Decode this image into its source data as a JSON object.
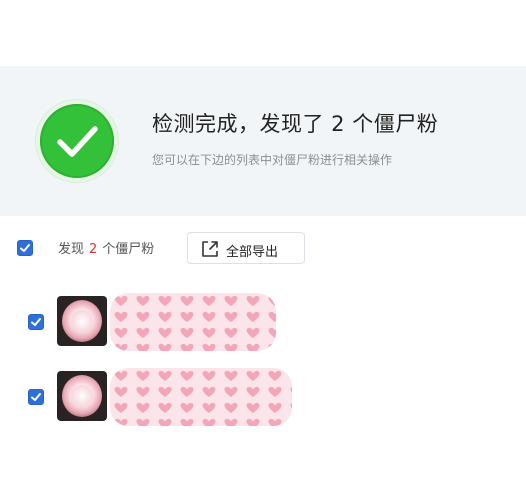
{
  "result": {
    "title": "检测完成，发现了 2 个僵尸粉",
    "subtitle": "您可以在下边的列表中对僵尸粉进行相关操作"
  },
  "summary": {
    "prefix": "发现",
    "count": "2",
    "suffix": "个僵尸粉"
  },
  "export_button": {
    "label": "全部导出",
    "icon": "export-icon"
  },
  "select_all": {
    "checked": true
  },
  "zombie_fans": [
    {
      "checked": true,
      "name_masked": true
    },
    {
      "checked": true,
      "name_masked": true
    }
  ],
  "colors": {
    "accent": "#2f6fd8",
    "success": "#34c13a",
    "count_highlight": "#e0352e",
    "mask_pink": "#f2a6b8"
  }
}
